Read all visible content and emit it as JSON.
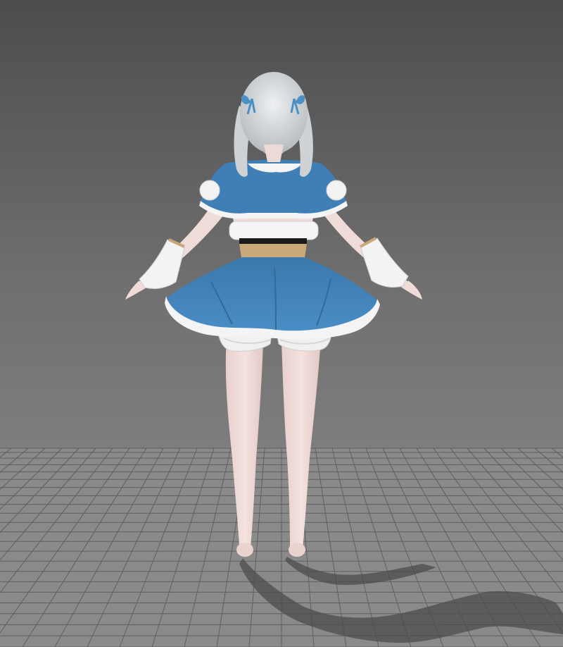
{
  "scene": {
    "type": "3d-viewport",
    "view": "back",
    "subject": "character-model",
    "colors": {
      "background_top": "#4d4d4d",
      "background_bottom": "#878787",
      "floor": "#8a8a8a",
      "grid_line": "#5f5f5f",
      "shadow": "#4a4a4a",
      "skin": "#eed9d6",
      "hair": "#d8dadc",
      "ribbon": "#4a90c4",
      "cape": "#3f7fb6",
      "skirt": "#4384bd",
      "trim": "#f4f4f4",
      "belt": "#c9a87a",
      "waist_band": "#1a1a1a",
      "bloomers": "#f0f0f0"
    }
  }
}
